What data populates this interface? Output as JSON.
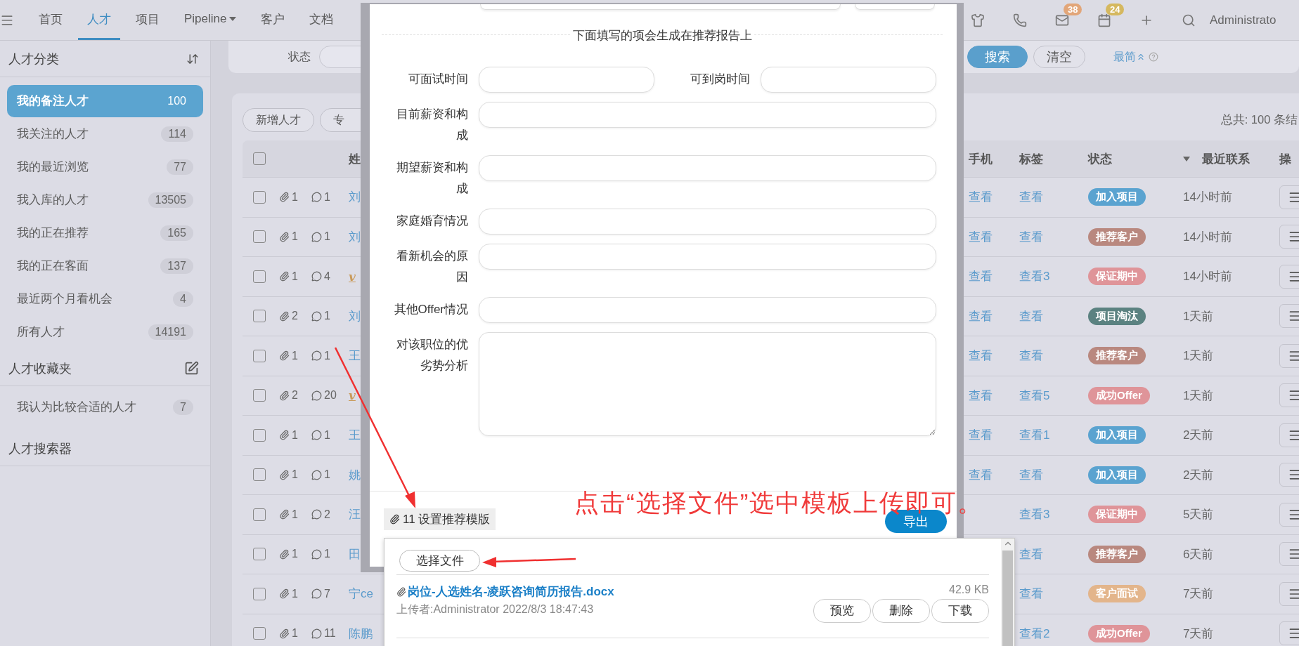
{
  "nav": {
    "items": [
      {
        "label": "首页",
        "selected": false
      },
      {
        "label": "人才",
        "selected": true
      },
      {
        "label": "项目",
        "selected": false
      },
      {
        "label": "Pipeline",
        "dropdown": true,
        "selected": false
      },
      {
        "label": "客户",
        "selected": false
      },
      {
        "label": "文档",
        "selected": false
      }
    ],
    "tools": [
      {
        "kind": "shirt"
      },
      {
        "kind": "phone"
      },
      {
        "kind": "mail",
        "badge": "38",
        "color": "#e2a679"
      },
      {
        "kind": "calendar",
        "badge": "24",
        "color": "#d5b85f"
      },
      {
        "kind": "plus"
      },
      {
        "kind": "search"
      }
    ],
    "user": "Administrato"
  },
  "sidebar": {
    "sections": [
      {
        "title": "人才分类",
        "kind": "sort",
        "items": [
          {
            "label": "我的备注人才",
            "count": "100",
            "selected": true
          },
          {
            "label": "我关注的人才",
            "count": "114",
            "selected": false
          },
          {
            "label": "我的最近浏览",
            "count": "77",
            "selected": false
          },
          {
            "label": "我入库的人才",
            "count": "13505",
            "selected": false
          },
          {
            "label": "我的正在推荐",
            "count": "165",
            "selected": false
          },
          {
            "label": "我的正在客面",
            "count": "137",
            "selected": false
          },
          {
            "label": "最近两个月看机会",
            "count": "4",
            "selected": false
          },
          {
            "label": "所有人才",
            "count": "14191",
            "selected": false
          }
        ]
      },
      {
        "title": "人才收藏夹",
        "kind": "edit",
        "items": [
          {
            "label": "我认为比较合适的人才",
            "count": "7",
            "selected": false
          }
        ]
      },
      {
        "title": "人才搜索器"
      }
    ]
  },
  "filter": {
    "label": "状态",
    "buttons": [
      {
        "label": "搜索",
        "kind": "primary"
      },
      {
        "label": "清空",
        "kind": "plain"
      }
    ],
    "link": "最简"
  },
  "toolbar": {
    "buttons": [
      "新增人才",
      "专"
    ],
    "total": "总共: 100 条结"
  },
  "table": {
    "checked": false,
    "columns": [
      {
        "label": "姓",
        "sorted": false
      },
      {
        "label": "手机",
        "sorted": false
      },
      {
        "label": "标签",
        "sorted": false
      },
      {
        "label": "状态",
        "sorted": false
      },
      {
        "label": "最近联系",
        "sorted": true
      },
      {
        "label": "操",
        "sorted": false
      }
    ],
    "rows": [
      {
        "checked": false,
        "attachments": "1",
        "comments": "1",
        "name": {
          "text": "刘",
          "kind": "link"
        },
        "phone": "查看",
        "tags": "查看",
        "status": {
          "label": "加入项目",
          "color": "#5aa3d0"
        },
        "last_contact": "14小时前"
      },
      {
        "checked": false,
        "attachments": "1",
        "comments": "1",
        "name": {
          "text": "刘",
          "kind": "link"
        },
        "phone": "查看",
        "tags": "查看",
        "status": {
          "label": "推荐客户",
          "color": "#b9887f"
        },
        "last_contact": "14小时前"
      },
      {
        "checked": false,
        "attachments": "1",
        "comments": "4",
        "name": {
          "text": "v",
          "kind": "vip"
        },
        "phone": "查看",
        "tags": "查看3",
        "status": {
          "label": "保证期中",
          "color": "#df9499"
        },
        "last_contact": "14小时前"
      },
      {
        "checked": false,
        "attachments": "2",
        "comments": "1",
        "name": {
          "text": "刘",
          "kind": "link"
        },
        "phone": "查看",
        "tags": "查看",
        "status": {
          "label": "项目淘汰",
          "color": "#5b8281"
        },
        "last_contact": "1天前"
      },
      {
        "checked": false,
        "attachments": "1",
        "comments": "1",
        "name": {
          "text": "王",
          "kind": "link"
        },
        "phone": "查看",
        "tags": "查看",
        "status": {
          "label": "推荐客户",
          "color": "#b9887f"
        },
        "last_contact": "1天前"
      },
      {
        "checked": false,
        "attachments": "2",
        "comments": "20",
        "name": {
          "text": "v",
          "kind": "vip"
        },
        "phone": "查看",
        "tags": "查看5",
        "status": {
          "label": "成功Offer",
          "color": "#df9499"
        },
        "last_contact": "1天前"
      },
      {
        "checked": false,
        "attachments": "1",
        "comments": "1",
        "name": {
          "text": "王",
          "kind": "link"
        },
        "phone": "查看",
        "tags": "查看1",
        "status": {
          "label": "加入项目",
          "color": "#5aa3d0"
        },
        "last_contact": "2天前"
      },
      {
        "checked": false,
        "attachments": "1",
        "comments": "1",
        "name": {
          "text": "姚",
          "kind": "link"
        },
        "phone": "查看",
        "tags": "查看",
        "status": {
          "label": "加入项目",
          "color": "#5aa3d0"
        },
        "last_contact": "2天前"
      },
      {
        "checked": false,
        "attachments": "1",
        "comments": "2",
        "name": {
          "text": "汪",
          "kind": "link"
        },
        "tags": "查看3",
        "status": {
          "label": "保证期中",
          "color": "#df9499"
        },
        "last_contact": "5天前"
      },
      {
        "checked": false,
        "attachments": "1",
        "comments": "1",
        "name": {
          "text": "田",
          "kind": "link"
        },
        "tags": "查看",
        "status": {
          "label": "推荐客户",
          "color": "#b9887f"
        },
        "last_contact": "6天前"
      },
      {
        "checked": false,
        "attachments": "1",
        "comments": "7",
        "name": {
          "text": "宁ce",
          "kind": "link"
        },
        "tags": "查看",
        "status": {
          "label": "客户面试",
          "color": "#e3b58b"
        },
        "last_contact": "7天前"
      },
      {
        "checked": false,
        "attachments": "1",
        "comments": "11",
        "name": {
          "text": "陈鹏",
          "kind": "link"
        },
        "tags": "查看2",
        "status": {
          "label": "成功Offer",
          "color": "#df9499"
        },
        "last_contact": "7天前"
      }
    ]
  },
  "modal": {
    "section_title": "下面填写的项会生成在推荐报告上",
    "fields": [
      {
        "label": "可面试时间",
        "kind": "half"
      },
      {
        "label": "可到岗时间",
        "kind": "half"
      },
      {
        "label": "目前薪资和构成",
        "kind": "full"
      },
      {
        "label": "期望薪资和构成",
        "kind": "full"
      },
      {
        "label": "家庭婚育情况",
        "kind": "full"
      },
      {
        "label": "看新机会的原因",
        "kind": "full"
      },
      {
        "label": "其他Offer情况",
        "kind": "full"
      },
      {
        "label": "对该职位的优劣势分析",
        "kind": "textarea"
      }
    ],
    "template_link": {
      "count": "11",
      "label": "设置推荐模版"
    },
    "export_button": "导出"
  },
  "upload_panel": {
    "choose_button": "选择文件",
    "files": [
      {
        "name": "岗位-人选姓名-凌跃咨询简历报告.docx",
        "size": "42.9 KB",
        "uploader": "上传者:Administrator 2022/8/3 18:47:43",
        "actions": [
          "预览",
          "删除",
          "下载"
        ]
      }
    ]
  },
  "annotation": {
    "text": "点击“选择文件”选中模板上传即可。"
  }
}
